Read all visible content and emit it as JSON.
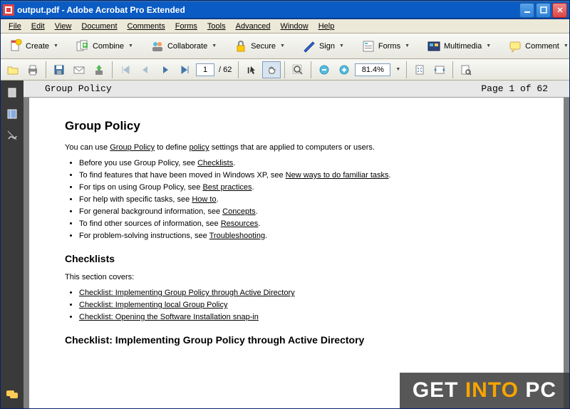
{
  "titlebar": {
    "filename": "output.pdf",
    "app": "Adobe Acrobat Pro Extended"
  },
  "menu": [
    "File",
    "Edit",
    "View",
    "Document",
    "Comments",
    "Forms",
    "Tools",
    "Advanced",
    "Window",
    "Help"
  ],
  "toolbar1": {
    "create": "Create",
    "combine": "Combine",
    "collaborate": "Collaborate",
    "secure": "Secure",
    "sign": "Sign",
    "forms": "Forms",
    "multimedia": "Multimedia",
    "comment": "Comment"
  },
  "nav": {
    "page_current": "1",
    "page_total": "62",
    "zoom": "81.4%"
  },
  "doc": {
    "running_head": "Group Policy",
    "page_label": "Page 1 of 62",
    "h1": "Group Policy",
    "intro_pre": "You can use ",
    "intro_link1": "Group Policy",
    "intro_mid": " to define ",
    "intro_link2": "policy",
    "intro_post": " settings that are applied to computers or users.",
    "bullets": [
      {
        "pre": "Before you use Group Policy, see ",
        "link": "Checklists",
        "post": "."
      },
      {
        "pre": "To find features that have been moved in Windows XP, see ",
        "link": "New ways to do familiar tasks",
        "post": "."
      },
      {
        "pre": "For tips on using Group Policy, see ",
        "link": "Best practices",
        "post": "."
      },
      {
        "pre": "For help with specific tasks, see ",
        "link": "How to",
        "post": "."
      },
      {
        "pre": "For general background information, see ",
        "link": "Concepts",
        "post": "."
      },
      {
        "pre": "To find other sources of information, see ",
        "link": "Resources",
        "post": "."
      },
      {
        "pre": "For problem-solving instructions, see ",
        "link": "Troubleshooting",
        "post": "."
      }
    ],
    "h2a": "Checklists",
    "covers": "This section covers:",
    "checklists": [
      "Checklist: Implementing Group Policy through Active Directory",
      "Checklist: Implementing local Group Policy",
      "Checklist: Opening the Software Installation snap-in"
    ],
    "h2b": "Checklist: Implementing Group Policy through Active Directory"
  },
  "watermark": {
    "a": "GET",
    "b": "INTO",
    "c": "PC"
  }
}
